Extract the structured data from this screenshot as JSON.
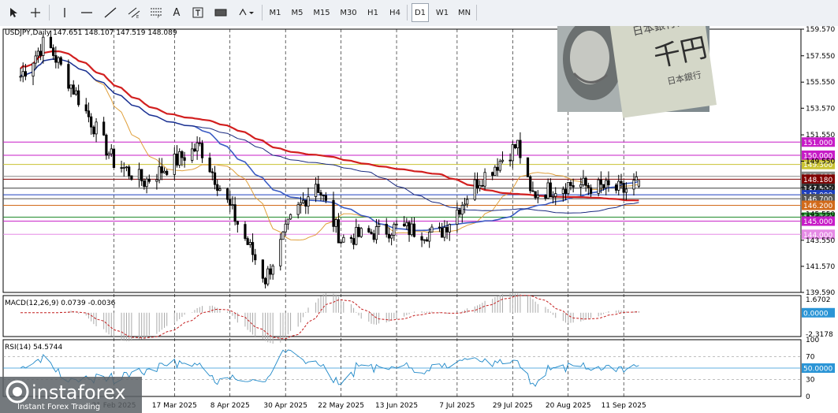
{
  "toolbar": {
    "tools": [
      {
        "icon": "cursor-icon"
      },
      {
        "icon": "crosshair-icon"
      },
      {
        "icon": "vertical-line-icon"
      },
      {
        "icon": "horizontal-line-icon"
      },
      {
        "icon": "trendline-icon"
      },
      {
        "icon": "equidistant-channel-icon"
      },
      {
        "icon": "fibonacci-icon"
      },
      {
        "icon": "text-icon",
        "label": "A"
      },
      {
        "icon": "text-label-icon"
      },
      {
        "icon": "rectangle-icon"
      },
      {
        "icon": "shapes-dropdown-icon"
      }
    ],
    "timeframes": [
      "M1",
      "M5",
      "M15",
      "M30",
      "H1",
      "H4",
      "D1",
      "W1",
      "MN"
    ],
    "active_timeframe": "D1"
  },
  "main_panel": {
    "header": "USDJPY,Daily  147.651 148.107 147.519 148.089",
    "price_scale": [
      "159.570",
      "157.550",
      "155.550",
      "153.570",
      "151.550",
      "149.550",
      "147.550",
      "145.550",
      "143.550",
      "141.570",
      "139.590"
    ],
    "levels": [
      {
        "label": "151.000",
        "value": 151.0,
        "color": "#c71cc7"
      },
      {
        "label": "150.000",
        "value": 150.0,
        "color": "#c71cc7"
      },
      {
        "label": "149.300",
        "value": 149.3,
        "color": "#c9c232"
      },
      {
        "label": "148.400",
        "value": 148.4,
        "color": "#888888"
      },
      {
        "label": "148.180",
        "value": 148.18,
        "color": "#800000"
      },
      {
        "label": "147.500",
        "value": 147.5,
        "color": "#3a3a3a"
      },
      {
        "label": "147.000",
        "value": 147.0,
        "color": "#1e3fbf"
      },
      {
        "label": "146.700",
        "value": 146.7,
        "color": "#555555"
      },
      {
        "label": "146.200",
        "value": 146.2,
        "color": "#d26a1a"
      },
      {
        "label": "145.300",
        "value": 145.3,
        "color": "#1f8a2a"
      },
      {
        "label": "145.000",
        "value": 145.0,
        "color": "#c71cc7"
      },
      {
        "label": "144.000",
        "value": 144.0,
        "color": "#e58ae5"
      }
    ]
  },
  "macd_panel": {
    "header": "MACD(12,26,9) 0.0739 -0.0036",
    "scale": [
      "1.6702",
      "-2.3178"
    ],
    "zero_label": "0.0000"
  },
  "rsi_panel": {
    "header": "RSI(14) 54.5744",
    "scale": [
      "100",
      "70",
      "30",
      "0"
    ],
    "level_label": "50.0000"
  },
  "date_axis": [
    "21 Feb 2025",
    "17 Mar 2025",
    "8 Apr 2025",
    "30 Apr 2025",
    "22 May 2025",
    "13 Jun 2025",
    "7 Jul 2025",
    "29 Jul 2025",
    "20 Aug 2025",
    "11 Sep 2025"
  ],
  "brand": {
    "name": "instaforex",
    "tagline": "Instant Forex Trading"
  },
  "chart_data": {
    "type": "candlestick",
    "symbol": "USDJPY",
    "timeframe": "Daily",
    "last_ohlc": {
      "open": 147.651,
      "high": 148.107,
      "low": 147.519,
      "close": 148.089
    },
    "ylim": [
      139.59,
      159.57
    ],
    "x_tick_labels": [
      "21 Feb 2025",
      "17 Mar 2025",
      "8 Apr 2025",
      "30 Apr 2025",
      "22 May 2025",
      "13 Jun 2025",
      "7 Jul 2025",
      "29 Jul 2025",
      "20 Aug 2025",
      "11 Sep 2025"
    ],
    "approx_close_path": [
      {
        "date": "2025-01-15",
        "close": 156.0
      },
      {
        "date": "2025-01-25",
        "close": 158.7
      },
      {
        "date": "2025-02-05",
        "close": 155.0
      },
      {
        "date": "2025-02-21",
        "close": 149.5
      },
      {
        "date": "2025-03-05",
        "close": 148.0
      },
      {
        "date": "2025-03-17",
        "close": 149.5
      },
      {
        "date": "2025-03-27",
        "close": 150.7
      },
      {
        "date": "2025-04-08",
        "close": 146.0
      },
      {
        "date": "2025-04-22",
        "close": 140.6
      },
      {
        "date": "2025-05-02",
        "close": 145.0
      },
      {
        "date": "2025-05-12",
        "close": 148.0
      },
      {
        "date": "2025-05-22",
        "close": 143.6
      },
      {
        "date": "2025-06-13",
        "close": 144.5
      },
      {
        "date": "2025-06-30",
        "close": 144.0
      },
      {
        "date": "2025-07-15",
        "close": 148.0
      },
      {
        "date": "2025-07-31",
        "close": 150.8
      },
      {
        "date": "2025-08-05",
        "close": 147.0
      },
      {
        "date": "2025-08-20",
        "close": 147.8
      },
      {
        "date": "2025-09-05",
        "close": 147.5
      },
      {
        "date": "2025-09-11",
        "close": 147.3
      },
      {
        "date": "2025-09-17",
        "close": 148.09
      }
    ],
    "rsi_last": 54.5744,
    "macd": {
      "main": 0.0739,
      "signal": -0.0036,
      "scale": [
        -2.3178,
        1.6702
      ]
    }
  }
}
